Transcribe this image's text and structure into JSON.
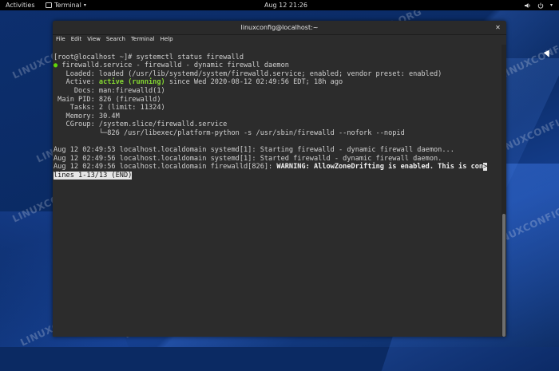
{
  "topbar": {
    "activities": "Activities",
    "app_name": "Terminal",
    "app_caret": "▾",
    "clock": "Aug 12  21:26",
    "power_icon": "power-icon",
    "volume_icon": "volume-icon"
  },
  "window": {
    "title": "linuxconfig@localhost:~",
    "close": "✕",
    "menu": [
      "File",
      "Edit",
      "View",
      "Search",
      "Terminal",
      "Help"
    ]
  },
  "terminal": {
    "prompt": "[root@localhost ~]# systemctl status firewalld",
    "service_dot": "●",
    "service_line": " firewalld.service - firewalld - dynamic firewall daemon",
    "loaded": "   Loaded: loaded (/usr/lib/systemd/system/firewalld.service; enabled; vendor preset: enabled)",
    "active_prefix": "   Active: ",
    "active_status": "active (running)",
    "active_suffix": " since Wed 2020-08-12 02:49:56 EDT; 18h ago",
    "docs": "     Docs: man:firewalld(1)",
    "main_pid": " Main PID: 826 (firewalld)",
    "tasks": "    Tasks: 2 (limit: 11324)",
    "memory": "   Memory: 30.4M",
    "cgroup": "   CGroup: /system.slice/firewalld.service",
    "cgroup_child": "           └─826 /usr/libexec/platform-python -s /usr/sbin/firewalld --nofork --nopid",
    "log1": "Aug 12 02:49:53 localhost.localdomain systemd[1]: Starting firewalld - dynamic firewall daemon...",
    "log2": "Aug 12 02:49:56 localhost.localdomain systemd[1]: Started firewalld - dynamic firewall daemon.",
    "log3_prefix": "Aug 12 02:49:56 localhost.localdomain firewalld[826]: ",
    "log3_warning": "WARNING: AllowZoneDrifting is enabled. This is con",
    "log3_cursor": ">",
    "pager": "lines 1-13/13 (END)"
  },
  "watermark": "LINUXCONFIG.ORG",
  "colors": {
    "terminal_bg": "#2c2c2c",
    "active_green": "#86d932",
    "desktop_blue": "#0b2a63"
  }
}
